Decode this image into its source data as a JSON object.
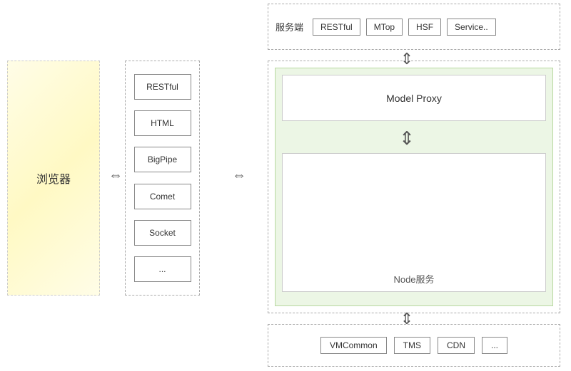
{
  "browser": {
    "label": "浏览器"
  },
  "protocols": {
    "items": [
      "RESTful",
      "HTML",
      "BigPipe",
      "Comet",
      "Socket",
      "..."
    ]
  },
  "serverTop": {
    "label": "服务端",
    "chips": [
      "RESTful",
      "MTop",
      "HSF",
      "Service.."
    ]
  },
  "modelProxy": {
    "label": "Model Proxy"
  },
  "nodeService": {
    "label": "Node服务"
  },
  "bottomServices": {
    "chips": [
      "VMCommon",
      "TMS",
      "CDN",
      "..."
    ]
  },
  "arrows": {
    "horizontal": "⇔",
    "vertical_up_down": "⇕"
  }
}
